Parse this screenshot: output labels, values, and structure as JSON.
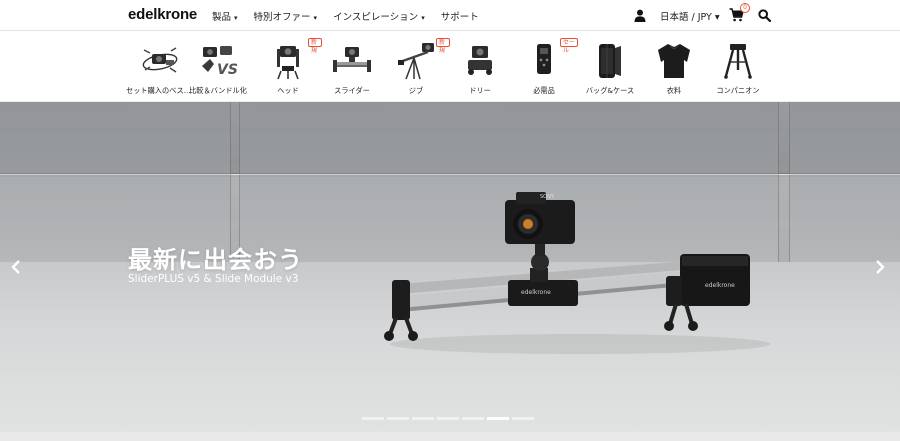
{
  "header": {
    "logo": "edelkrone",
    "nav": [
      {
        "label": "製品",
        "caret": "▾"
      },
      {
        "label": "特別オファー",
        "caret": "▾"
      },
      {
        "label": "インスピレーション",
        "caret": "▾"
      },
      {
        "label": "サポート",
        "caret": ""
      }
    ],
    "language": "日本語 / JPY ▾",
    "cart_count": "0",
    "accent_color": "#e8503a"
  },
  "categories": [
    {
      "label": "セット購入のベスト…",
      "badge": ""
    },
    {
      "label": "比較＆バンドル化",
      "badge": ""
    },
    {
      "label": "ヘッド",
      "badge": "新規"
    },
    {
      "label": "スライダー",
      "badge": ""
    },
    {
      "label": "ジブ",
      "badge": "新規"
    },
    {
      "label": "ドリー",
      "badge": ""
    },
    {
      "label": "必需品",
      "badge": "セール"
    },
    {
      "label": "バッグ&ケース",
      "badge": ""
    },
    {
      "label": "衣料",
      "badge": ""
    },
    {
      "label": "コンパニオン",
      "badge": ""
    }
  ],
  "hero": {
    "title": "最新に出会おう",
    "subtitle": "SliderPLUS v5 & Slide Module v3",
    "slide_count": 7,
    "active_slide": 6,
    "camera_brand": "SONY",
    "product_brand": "edelkrone"
  }
}
